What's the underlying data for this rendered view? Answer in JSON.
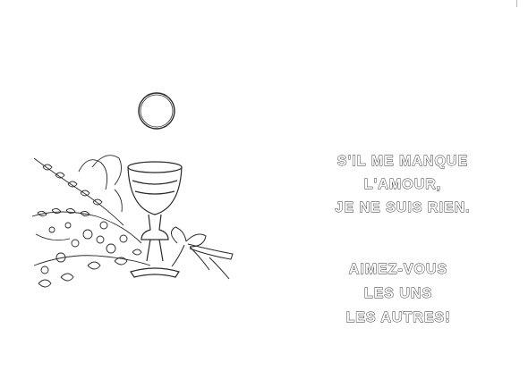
{
  "card": {
    "background": "#ffffff",
    "ink_color": "#2a2a2a"
  },
  "illustration": {
    "icons": [
      "host-circle-icon",
      "chalice-icon",
      "wheat-and-flowers-icon",
      "ribbon-bow-icon"
    ]
  },
  "verse": {
    "lines": [
      "S'IL ME MANQUE",
      "L'AMOUR,",
      "JE NE SUIS RIEN."
    ]
  },
  "exhortation": {
    "lines": [
      "AIMEZ-VOUS",
      "LES UNS",
      "LES AUTRES!"
    ]
  }
}
